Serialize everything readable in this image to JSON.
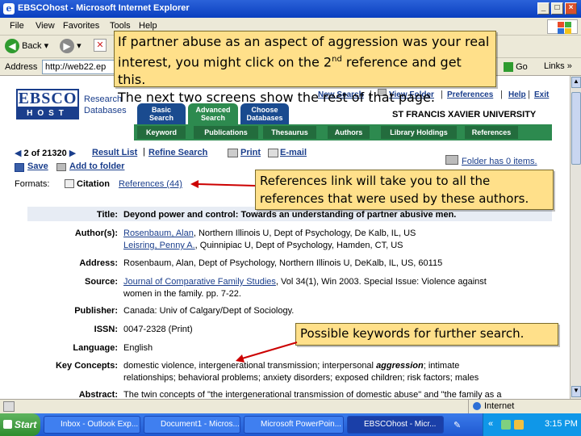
{
  "window": {
    "title": "EBSCOhost - Microsoft Internet Explorer",
    "controls": [
      "_",
      "□",
      "×"
    ]
  },
  "menu": [
    "File",
    "View",
    "Favorites",
    "Tools",
    "Help"
  ],
  "toolbar": {
    "back_label": "Back"
  },
  "address": {
    "label": "Address",
    "value": "http://web22.ep",
    "go_label": "Go",
    "links_label": "Links"
  },
  "site": {
    "logo_top": "EBSCO",
    "logo_bottom": "HOST",
    "logo_side": [
      "Research",
      "Databases"
    ],
    "tabs": [
      {
        "line1": "Basic",
        "line2": "Search"
      },
      {
        "line1": "Advanced",
        "line2": "Search"
      },
      {
        "line1": "Choose",
        "line2": "Databases"
      }
    ],
    "toplinks": [
      "New Search",
      "View Folder",
      "Preferences",
      "Help",
      "Exit"
    ],
    "university": "ST FRANCIS XAVIER UNIVERSITY",
    "green_tabs": [
      "Keyword",
      "Publications",
      "Thesaurus",
      "Authors",
      "Library Holdings",
      "References"
    ]
  },
  "record": {
    "position": "2 of 21320",
    "result_list": "Result List",
    "refine_search": "Refine Search",
    "print": "Print",
    "email": "E-mail",
    "save": "Save",
    "add_to_folder": "Add to folder",
    "folder_status": "Folder has 0 items.",
    "formats_label": "Formats:",
    "citation": "Citation",
    "references": "References (44)",
    "fields": {
      "title_label": "Title:",
      "title_value": "Deyond power and control: Towards an understanding of partner abusive men.",
      "authors_label": "Author(s):",
      "author1_name": "Rosenbaum, Alan",
      "author1_rest": ", Northern Illinois U, Dept of Psychology, De Kalb, IL, US",
      "author2_name": "Leisring, Penny A.",
      "author2_rest": ", Quinnipiac U, Dept of Psychology, Hamden, CT, US",
      "address_label": "Address:",
      "address_value": "Rosenbaum, Alan, Dept of Psychology, Northern Illinois U, DeKalb, IL, US, 60115",
      "source_label": "Source:",
      "source_journal": "Journal of Comparative Family Studies",
      "source_rest": ", Vol 34(1), Win 2003. Special Issue: Violence against",
      "source_line2": "women in the family. pp. 7-22.",
      "publisher_label": "Publisher:",
      "publisher_value": "Canada: Univ of Calgary/Dept of Sociology.",
      "issn_label": "ISSN:",
      "issn_value": "0047-2328 (Print)",
      "language_label": "Language:",
      "language_value": "English",
      "keywords_label": "Key Concepts:",
      "keywords_line1_a": "domestic violence, intergenerational transmission; interpersonal",
      "keywords_line1_b": "aggression",
      "keywords_line1_c": "; intimate",
      "keywords_line2": "relationships; behavioral problems; anxiety disorders; exposed children; risk factors; males",
      "abstract_label": "Abstract:",
      "abstract_value": "The twin concepts of \"the intergenerational transmission of domestic abuse\" and \"the family as a"
    }
  },
  "callouts": {
    "main_line1": "If partner abuse as an aspect of aggression was your real",
    "main_line2_a": "interest, you might click on the 2",
    "main_line2_sup": "nd",
    "main_line2_b": " reference and get this.",
    "main_line3": "The next two screens show the rest of that page.",
    "references_note": "References link will take you to all the references that were used by these authors.",
    "keywords_note": "Possible keywords for further search."
  },
  "status": {
    "zone": "Internet"
  },
  "taskbar": {
    "start": "Start",
    "tasks": [
      "Inbox - Outlook Exp...",
      "Document1 - Micros...",
      "Microsoft PowerPoin...",
      "EBSCOhost - Micr..."
    ],
    "clock": "3:15 PM"
  },
  "colors": {
    "ebsco_blue": "#1a3e8c",
    "ebsco_green": "#2d8a4f",
    "callout_fill": "#ffe08a",
    "arrow_red": "#cc0000"
  }
}
